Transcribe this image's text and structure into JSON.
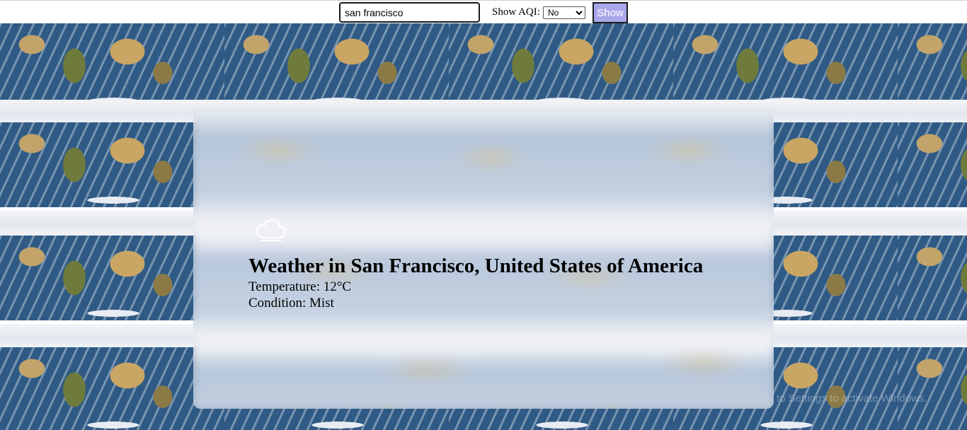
{
  "search": {
    "value": "san francisco",
    "aqi_label": "Show AQI:",
    "aqi_selected": "No",
    "aqi_options": [
      "No"
    ],
    "button_label": "Show"
  },
  "weather": {
    "icon": "cloud-icon",
    "title": "Weather in San Francisco, United States of America",
    "temperature": "Temperature: 12°C",
    "condition": "Condition: Mist"
  },
  "watermark": "to Settings to activate Windows.",
  "colors": {
    "button_bg": "#a9a7ea",
    "ocean": "#2f5a85"
  }
}
